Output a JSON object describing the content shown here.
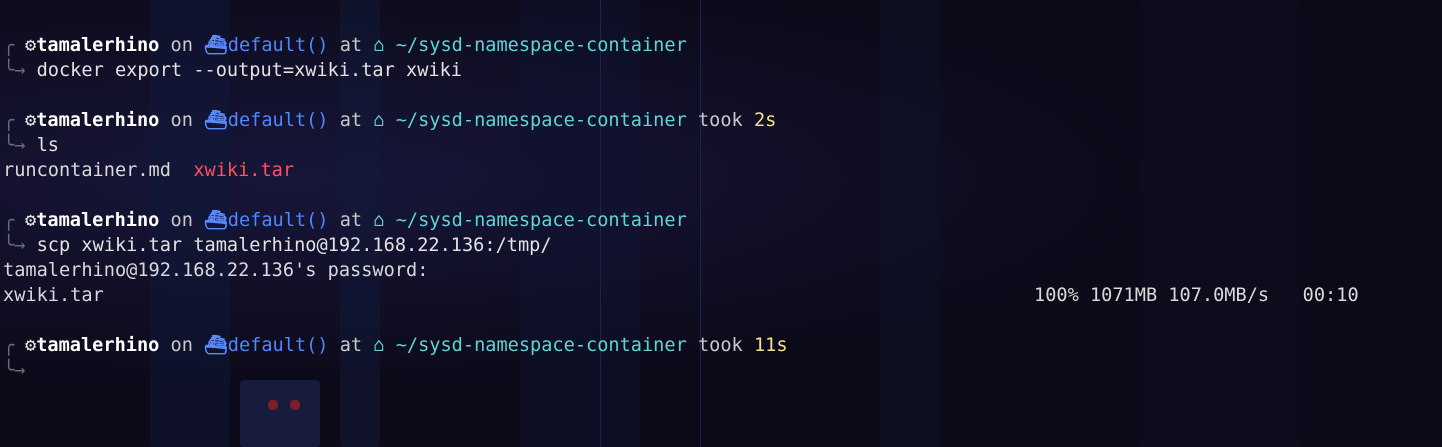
{
  "colors": {
    "background": "#0c0a18",
    "user": "#ffffff",
    "context": "#4f86ff",
    "path": "#5fd4d4",
    "duration": "#f5e28a",
    "archive_file": "#ff4f5e"
  },
  "icons": {
    "os": "ubuntu-icon",
    "context": "docker-ship-icon",
    "home": "home-icon"
  },
  "glyphs": {
    "os": "⚙",
    "context": "⛴",
    "home": "⌂",
    "corner_top": "╭",
    "corner_bottom": "╰→"
  },
  "prompts": [
    {
      "user": "tamalerhino",
      "on": "on",
      "context": "default()",
      "at": "at",
      "path": "~/sysd-namespace-container",
      "took": "",
      "duration": "",
      "command": "docker export --output=xwiki.tar xwiki"
    },
    {
      "user": "tamalerhino",
      "on": "on",
      "context": "default()",
      "at": "at",
      "path": "~/sysd-namespace-container",
      "took": "took",
      "duration": "2s",
      "command": "ls"
    },
    {
      "user": "tamalerhino",
      "on": "on",
      "context": "default()",
      "at": "at",
      "path": "~/sysd-namespace-container",
      "took": "",
      "duration": "",
      "command": "scp xwiki.tar tamalerhino@192.168.22.136:/tmp/"
    },
    {
      "user": "tamalerhino",
      "on": "on",
      "context": "default()",
      "at": "at",
      "path": "~/sysd-namespace-container",
      "took": "took",
      "duration": "11s",
      "command": ""
    }
  ],
  "ls_output": {
    "file1": "runcontainer.md",
    "file2": "xwiki.tar"
  },
  "scp_output": {
    "password_prompt": "tamalerhino@192.168.22.136's password:",
    "filename": "xwiki.tar",
    "progress": "100% 1071MB 107.0MB/s   00:10"
  }
}
